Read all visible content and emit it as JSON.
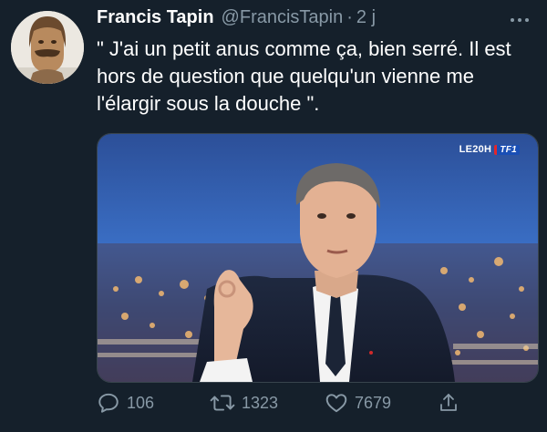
{
  "tweet": {
    "author_name": "Francis Tapin",
    "handle": "@FrancisTapin",
    "separator": "·",
    "time": "2 j",
    "text": "\" J'ai un petit anus comme ça, bien serré. Il est hors de question que quelqu'un vienne me l'élargir sous la douche \".",
    "media": {
      "channel_text": "LE20H",
      "channel_mark": "TF1"
    },
    "actions": {
      "replies": "106",
      "retweets": "1323",
      "likes": "7679"
    }
  },
  "icons": {
    "more": "more-dots-icon",
    "reply": "reply-bubble-icon",
    "retweet": "retweet-icon",
    "like": "heart-icon",
    "share": "share-icon"
  },
  "colors": {
    "background": "#15202b",
    "secondary_text": "#8899a6",
    "border": "#38444d"
  }
}
